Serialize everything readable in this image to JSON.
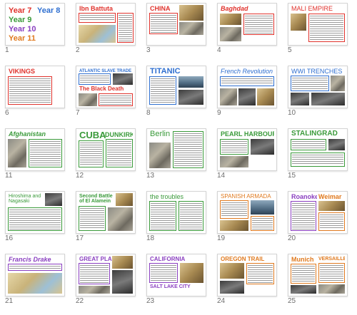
{
  "slides": [
    {
      "number": "1",
      "titles": [
        "Year 7",
        "Year 8",
        "Year 9",
        "Year 10",
        "Year 11"
      ],
      "accent": "#e0322c"
    },
    {
      "number": "2",
      "title": "Ibn Battuta",
      "accent": "#e0322c"
    },
    {
      "number": "3",
      "title": "CHINA",
      "accent": "#e0322c"
    },
    {
      "number": "4",
      "title": "Baghdad",
      "accent": "#e0322c"
    },
    {
      "number": "5",
      "title": "MALI EMPIRE",
      "accent": "#e0322c"
    },
    {
      "number": "6",
      "title": "VIKINGS",
      "accent": "#e0322c"
    },
    {
      "number": "7",
      "title": "ATLANTIC SLAVE TRADE",
      "title2": "The Black Death",
      "accent": "#2f6fd0",
      "accent2": "#e0322c"
    },
    {
      "number": "8",
      "title": "TITANIC",
      "accent": "#2f6fd0"
    },
    {
      "number": "9",
      "title": "French Revolution",
      "accent": "#2f6fd0"
    },
    {
      "number": "10",
      "title": "WWI TRENCHES",
      "accent": "#2f6fd0"
    },
    {
      "number": "11",
      "title": "Afghanistan",
      "accent": "#3a9a3a"
    },
    {
      "number": "12",
      "title": "CUBA",
      "title2": "DUNKIRK",
      "accent": "#3a9a3a"
    },
    {
      "number": "13",
      "title": "Berlin",
      "accent": "#3a9a3a"
    },
    {
      "number": "14",
      "title": "PEARL HARBOUR",
      "accent": "#3a9a3a"
    },
    {
      "number": "15",
      "title": "STALINGRAD",
      "accent": "#3a9a3a"
    },
    {
      "number": "16",
      "title": "Hiroshima and",
      "title2": "Nagasaki",
      "accent": "#3a9a3a"
    },
    {
      "number": "17",
      "title": "Second Battle",
      "title2": "of El Alamein",
      "accent": "#3a9a3a"
    },
    {
      "number": "18",
      "title": "the troubles",
      "accent": "#3a9a3a"
    },
    {
      "number": "19",
      "title": "SPANISH ARMADA",
      "accent": "#e07a1f"
    },
    {
      "number": "20",
      "title": "Roanoke",
      "title2": "Weimar",
      "accent": "#8a3fc0",
      "accent2": "#e07a1f"
    },
    {
      "number": "21",
      "title": "Francis Drake",
      "accent": "#8a3fc0"
    },
    {
      "number": "22",
      "title": "GREAT PLAINS",
      "accent": "#8a3fc0"
    },
    {
      "number": "23",
      "title": "CALIFORNIA",
      "title2": "SALT LAKE CITY",
      "accent": "#8a3fc0"
    },
    {
      "number": "24",
      "title": "OREGON TRAIL",
      "accent": "#e07a1f"
    },
    {
      "number": "25",
      "title": "Munich",
      "title2": "VERSAILLES",
      "accent": "#e07a1f"
    }
  ],
  "cover_colors": {
    "year7": "#e0322c",
    "year8": "#2f6fd0",
    "year9": "#3a9a3a",
    "year10": "#8a3fc0",
    "year11": "#e07a1f"
  }
}
